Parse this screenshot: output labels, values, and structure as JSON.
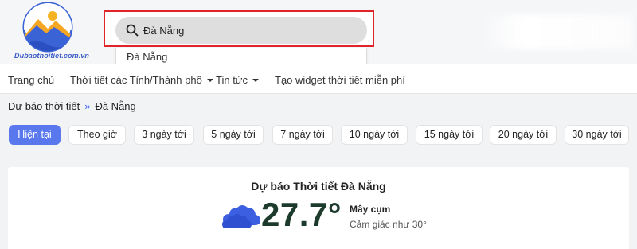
{
  "header": {
    "logo_text": "Dubaothoitiet.com.vn",
    "search": {
      "value": "Đà Nẵng",
      "suggestion": "Đà Nẵng"
    }
  },
  "nav": {
    "items": [
      {
        "label": "Trang chủ",
        "has_dropdown": false
      },
      {
        "label": "Thời tiết các Tỉnh/Thành phố",
        "has_dropdown": true
      },
      {
        "label": "Tin tức",
        "has_dropdown": true
      },
      {
        "label": "Tạo widget thời tiết miễn phí",
        "has_dropdown": false
      }
    ]
  },
  "breadcrumb": {
    "root": "Dự báo thời tiết",
    "separator": "»",
    "current": "Đà Nẵng"
  },
  "tabs": [
    {
      "label": "Hiện tại",
      "active": true
    },
    {
      "label": "Theo giờ",
      "active": false
    },
    {
      "label": "3 ngày tới",
      "active": false
    },
    {
      "label": "5 ngày tới",
      "active": false
    },
    {
      "label": "7 ngày tới",
      "active": false
    },
    {
      "label": "10 ngày tới",
      "active": false
    },
    {
      "label": "15 ngày tới",
      "active": false
    },
    {
      "label": "20 ngày tới",
      "active": false
    },
    {
      "label": "30 ngày tới",
      "active": false
    }
  ],
  "weather": {
    "title": "Dự báo Thời tiết Đà Nẵng",
    "temperature": "27.7°",
    "condition": "Mây cụm",
    "feels_like": "Cảm giác như 30°",
    "icon": "cloud-icon"
  },
  "colors": {
    "accent": "#5a78ee",
    "highlight_border": "#e0242a",
    "temperature_text": "#1d3b2c",
    "cloud": "#3b5fe0"
  }
}
